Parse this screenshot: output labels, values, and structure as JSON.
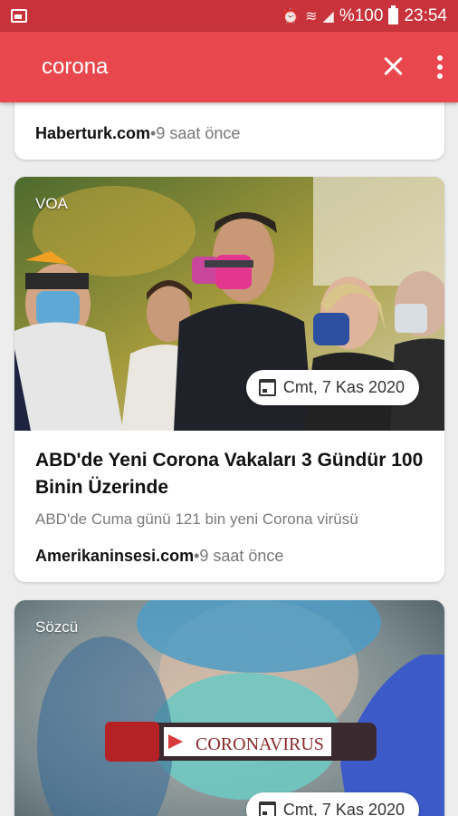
{
  "status_bar": {
    "battery": "%100",
    "time": "23:54"
  },
  "search": {
    "query": "corona"
  },
  "articles": [
    {
      "source": "Haberturk.com",
      "age": "•9 saat önce"
    },
    {
      "tag": "VOA",
      "date": "Cmt, 7 Kas 2020",
      "title": "ABD'de Yeni Corona Vakaları 3 Gündür 100 Binin Üzerinde",
      "summary": "ABD'de Cuma günü 121 bin yeni Corona virüsü",
      "source": "Amerikaninsesi.com",
      "age": "•9 saat önce"
    },
    {
      "tag": "Sözcü",
      "date": "Cmt, 7 Kas 2020",
      "image_text": "CORONAVIRUS"
    }
  ],
  "colors": {
    "status_bar": "#c8323a",
    "app_bar": "#e8474d",
    "background": "#ededed"
  }
}
